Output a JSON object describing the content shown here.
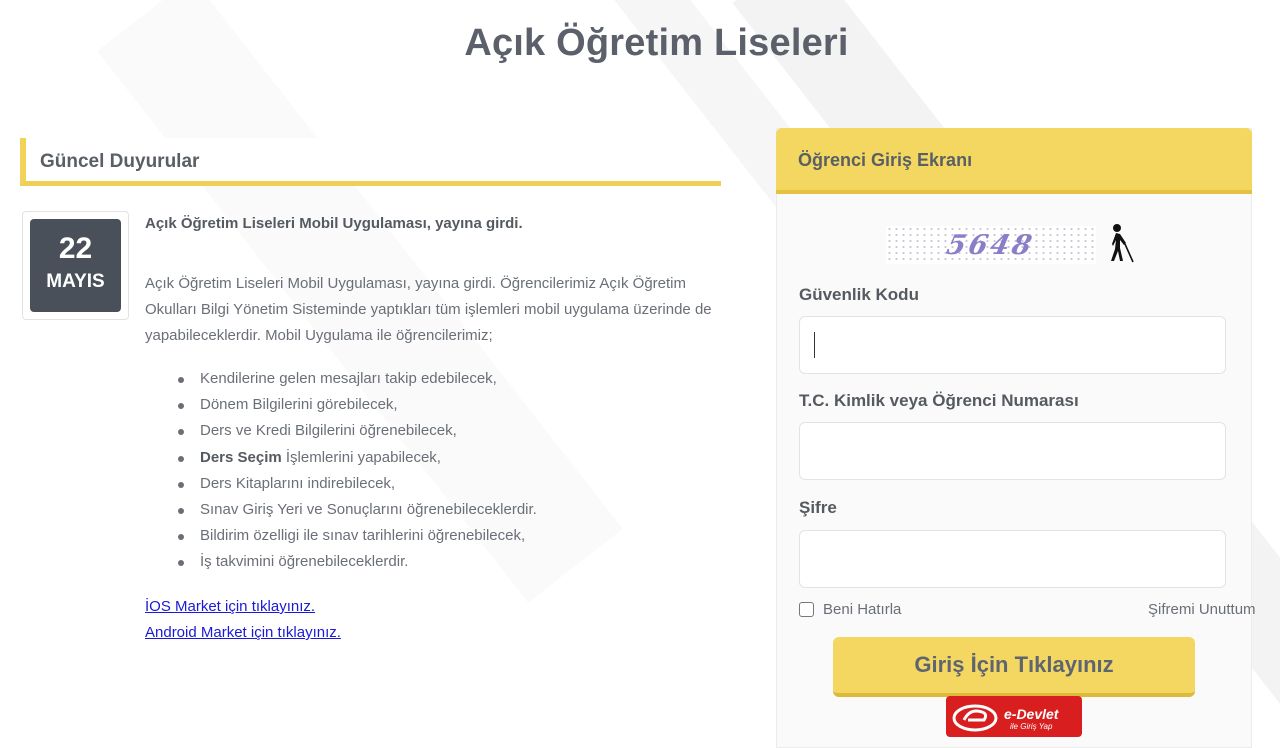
{
  "page": {
    "title": "Açık Öğretim Liseleri"
  },
  "news": {
    "header": "Güncel Duyurular",
    "date_day": "22",
    "date_month": "MAYIS",
    "title": "Açık Öğretim Liseleri Mobil Uygulaması, yayına girdi.",
    "body": "Açık Öğretim Liseleri Mobil Uygulaması, yayına girdi. Öğrencilerimiz Açık Öğretim Okulları Bilgi Yönetim Sisteminde yaptıkları tüm işlemleri mobil uygulama üzerinde de yapabileceklerdir. Mobil Uygulama ile öğrencilerimiz;",
    "items": [
      "Kendilerine gelen mesajları takip edebilecek,",
      "Dönem Bilgilerini görebilecek,",
      "Ders ve Kredi Bilgilerini öğrenebilecek,",
      {
        "bold": "Ders Seçim",
        "rest": " İşlemlerini yapabilecek,"
      },
      "Ders Kitaplarını indirebilecek,",
      "Sınav Giriş Yeri ve Sonuçlarını öğrenebileceklerdir.",
      "Bildirim özelligi ile sınav tarihlerini öğrenebilecek,",
      "İş takvimini öğrenebileceklerdir."
    ],
    "ios_link": "İOS Market için tıklayınız.",
    "android_link": "Android Market için tıklayınız."
  },
  "login": {
    "header": "Öğrenci Giriş Ekranı",
    "captcha_text": "5648",
    "security_label": "Güvenlik Kodu",
    "security_value": "",
    "id_label": "T.C. Kimlik veya Öğrenci Numarası",
    "id_value": "",
    "password_label": "Şifre",
    "password_value": "",
    "remember_label": "Beni Hatırla",
    "forgot_label": "Şifremi Unuttum",
    "submit_label": "Giriş İçin Tıklayınız",
    "edevlet_title": "e-Devlet",
    "edevlet_sub": "ile Giriş Yap"
  },
  "icons": {
    "audio_captcha": "accessibility-walking-person-icon",
    "edevlet_logo": "edevlet-logo-icon"
  },
  "colors": {
    "accent_yellow": "#f3d761",
    "dark_gray": "#4a5059",
    "text_gray": "#5a5f66",
    "link_blue": "#1a1ad6",
    "edevlet_red": "#d81e1e"
  }
}
